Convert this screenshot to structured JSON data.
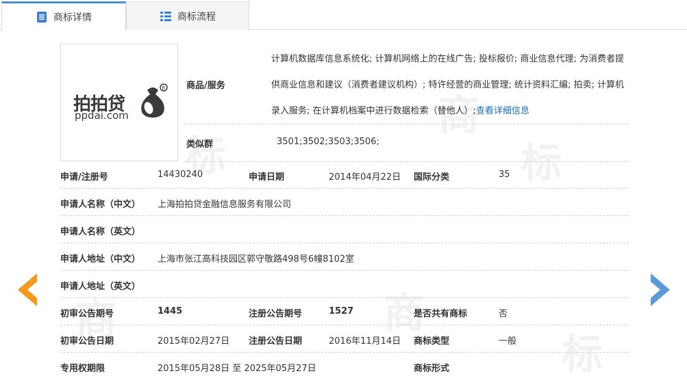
{
  "tabs": [
    {
      "label": "商标详情",
      "active": true,
      "icon": "document-icon"
    },
    {
      "label": "商标流程",
      "active": false,
      "icon": "list-icon"
    }
  ],
  "logo": {
    "cn": "拍拍贷",
    "en": "ppdai.com"
  },
  "goods": {
    "label": "商品/服务",
    "text": "计算机数据库信息系统化; 计算机网络上的在线广告; 投标报价; 商业信息代理; 为消费者提供商业信息和建议（消费者建议机构）; 特许经营的商业管理; 统计资料汇编; 拍卖; 计算机录入服务; 在计算机档案中进行数据检索（替他人）;",
    "link": "查看详细信息"
  },
  "similar": {
    "label": "类似群",
    "value": "3501;3502;3503;3506;"
  },
  "rows": {
    "reg_no_label": "申请/注册号",
    "reg_no": "14430240",
    "apply_date_label": "申请日期",
    "apply_date": "2014年04月22日",
    "intl_class_label": "国际分类",
    "intl_class": "35",
    "applicant_cn_label": "申请人名称（中文）",
    "applicant_cn": "上海拍拍贷金融信息服务有限公司",
    "applicant_en_label": "申请人名称（英文）",
    "applicant_en": "",
    "address_cn_label": "申请人地址（中文）",
    "address_cn": "上海市张江高科技园区郭守敬路498号6幢8102室",
    "address_en_label": "申请人地址（英文）",
    "address_en": "",
    "prelim_no_label": "初审公告期号",
    "prelim_no": "1445",
    "reg_pub_no_label": "注册公告期号",
    "reg_pub_no": "1527",
    "shared_label": "是否共有商标",
    "shared": "否",
    "prelim_date_label": "初审公告日期",
    "prelim_date": "2015年02月27日",
    "reg_pub_date_label": "注册公告日期",
    "reg_pub_date": "2016年11月14日",
    "tm_type_label": "商标类型",
    "tm_type": "一般",
    "exclusive_label": "专用权期限",
    "exclusive": "2015年05月28日 至 2025年05月27日",
    "tm_form_label": "商标形式",
    "tm_form": ""
  },
  "nav": {
    "prev_icon": "chevron-left-icon",
    "next_icon": "chevron-right-icon"
  },
  "colors": {
    "accent": "#4a90d9",
    "prev_arrow": "#f39a1e",
    "next_arrow": "#5b9bd5",
    "link": "#1a6fc9"
  },
  "watermark": "商标"
}
